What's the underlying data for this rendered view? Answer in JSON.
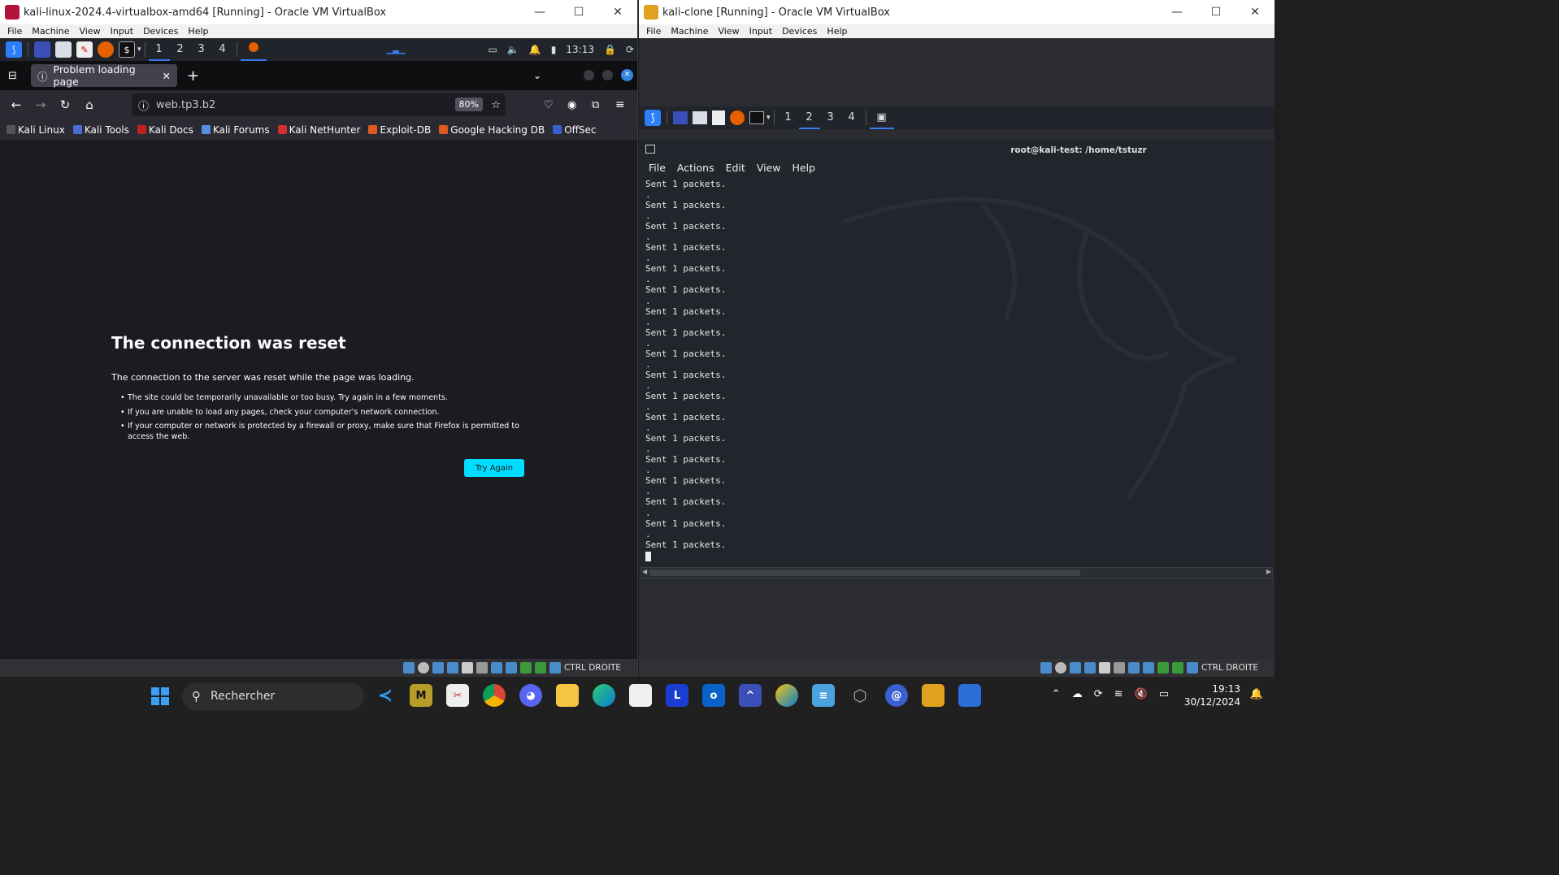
{
  "left_vm": {
    "title": "kali-linux-2024.4-virtualbox-amd64 [Running] - Oracle VM VirtualBox",
    "menu": [
      "File",
      "Machine",
      "View",
      "Input",
      "Devices",
      "Help"
    ],
    "workspaces": [
      "1",
      "2",
      "3",
      "4"
    ],
    "clock": "13:13",
    "tab_title": "Problem loading page",
    "url": "web.tp3.b2",
    "zoom": "80%",
    "bookmarks": [
      "Kali Linux",
      "Kali Tools",
      "Kali Docs",
      "Kali Forums",
      "Kali NetHunter",
      "Exploit-DB",
      "Google Hacking DB",
      "OffSec"
    ],
    "error": {
      "heading": "The connection was reset",
      "message": "The connection to the server was reset while the page was loading.",
      "bullets": [
        "The site could be temporarily unavailable or too busy. Try again in a few moments.",
        "If you are unable to load any pages, check your computer’s network connection.",
        "If your computer or network is protected by a firewall or proxy, make sure that Firefox is permitted to access the web."
      ],
      "button": "Try Again"
    },
    "host_key": "CTRL DROITE"
  },
  "right_vm": {
    "title": "kali-clone [Running] - Oracle VM VirtualBox",
    "menu": [
      "File",
      "Machine",
      "View",
      "Input",
      "Devices",
      "Help"
    ],
    "workspaces": [
      "1",
      "2",
      "3",
      "4"
    ],
    "terminal_title": "root@kali-test: /home/tstuzr",
    "terminal_menu": [
      "File",
      "Actions",
      "Edit",
      "View",
      "Help"
    ],
    "terminal_line": "Sent 1 packets.",
    "host_key": "CTRL DROITE"
  },
  "taskbar": {
    "search_placeholder": "Rechercher",
    "time": "19:13",
    "date": "30/12/2024"
  },
  "colors": {
    "accent": "#367bf0",
    "try_again": "#00ddff",
    "kali_blue": "#2d7ff9"
  }
}
